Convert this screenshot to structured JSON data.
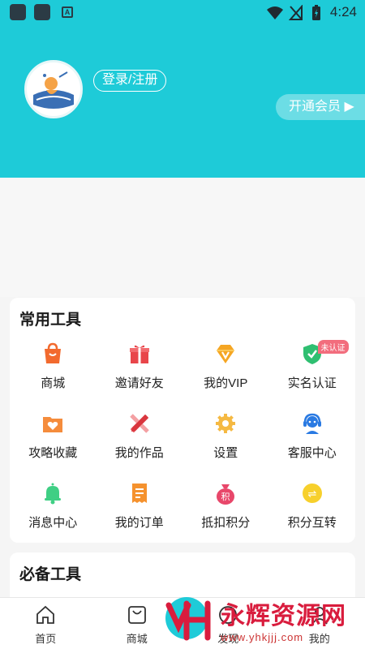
{
  "status_bar": {
    "time": "4:24",
    "indicator_a": "A"
  },
  "header": {
    "login_label": "登录/注册",
    "vip_label": "开通会员 ▶"
  },
  "colors": {
    "accent": "#1ecbd8",
    "watermark": "#d91c3d"
  },
  "common_tools": {
    "title": "常用工具",
    "items": [
      {
        "label": "商城",
        "icon": "shopping-bag-icon"
      },
      {
        "label": "邀请好友",
        "icon": "gift-icon"
      },
      {
        "label": "我的VIP",
        "icon": "vip-diamond-icon"
      },
      {
        "label": "实名认证",
        "icon": "shield-check-icon",
        "badge": "未认证"
      },
      {
        "label": "攻略收藏",
        "icon": "heart-folder-icon"
      },
      {
        "label": "我的作品",
        "icon": "pencil-ruler-icon"
      },
      {
        "label": "设置",
        "icon": "gear-icon"
      },
      {
        "label": "客服中心",
        "icon": "headset-icon"
      },
      {
        "label": "消息中心",
        "icon": "bell-icon"
      },
      {
        "label": "我的订单",
        "icon": "receipt-icon"
      },
      {
        "label": "抵扣积分",
        "icon": "money-bag-icon",
        "icon_text": "积"
      },
      {
        "label": "积分互转",
        "icon": "exchange-coin-icon",
        "icon_text": "⇌"
      }
    ]
  },
  "essential_tools": {
    "title": "必备工具"
  },
  "tab_bar": {
    "items": [
      {
        "label": "首页",
        "icon": "home-icon"
      },
      {
        "label": "商城",
        "icon": "shopping-bag-icon"
      },
      {
        "label": "发现",
        "icon": "discover-icon"
      },
      {
        "label": "我的",
        "icon": "profile-icon"
      }
    ]
  },
  "watermark": {
    "text": "永辉资源网",
    "url": "www.yhkjjj.com"
  }
}
